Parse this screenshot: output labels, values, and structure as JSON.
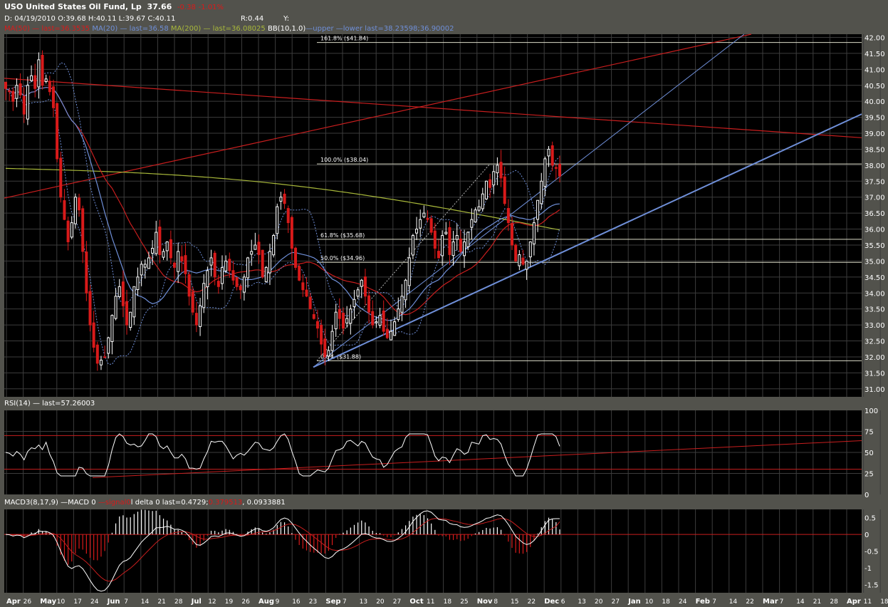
{
  "header": {
    "symbol_name": "USO United States Oil Fund, Lp",
    "last_price": "37.66",
    "change": "-0.38",
    "change_pct": "-1.01%",
    "ohlc": "D: 04/19/2010 O:39.68 H:40.11 L:39.67 C:40.11",
    "ratio": "R:0.44",
    "y_label": "Y:",
    "ma50": "MA(50) — last=36.3535",
    "ma20": "MA(20) — last=36.58",
    "ma200_prefix": "MA(200)",
    "ma200": "— last=36.08025",
    "bb_prefix": "BB(10,1.0)",
    "bb": "—upper —lower last=38.23598;36.90002"
  },
  "panels": {
    "rsi_title": "RSI(14) — last=57.26003",
    "macd_prefix": "MACD3(8,17,9) —MACD 0",
    "macd_signal": "—signal0",
    "macd_mid": "l delta 0 last=0.4729;",
    "macd_sig_val": "0.379513",
    "macd_delta_val": "0.0933881"
  },
  "colors": {
    "background": "#000000",
    "frame": "#52524c",
    "grid": "#3c3c3c",
    "candle_up": "#ffffff",
    "candle_down": "#d81a1a",
    "ma50": "#c81e1e",
    "ma20": "#6f8fd8",
    "ma200": "#a8b83a",
    "bb": "#6f8fd8",
    "trendline_red": "#c81e1e",
    "trendline_blue": "#6f8fd8",
    "fib": "#dcdcc8"
  },
  "chart_data": [
    {
      "type": "candlestick",
      "ylim": [
        30.75,
        42.1
      ],
      "yticks": [
        "42.00",
        "41.50",
        "41.00",
        "40.50",
        "40.00",
        "39.50",
        "39.00",
        "38.50",
        "38.00",
        "37.50",
        "37.00",
        "36.50",
        "36.00",
        "35.50",
        "35.00",
        "34.50",
        "34.00",
        "33.50",
        "33.00",
        "32.50",
        "32.00",
        "31.50",
        "31.00"
      ],
      "x_labels": [
        "Apr",
        "26",
        "May",
        "10",
        "17",
        "24",
        "Jun",
        "7",
        "14",
        "21",
        "28",
        "Jul",
        "12",
        "19",
        "26",
        "Aug",
        "9",
        "16",
        "23",
        "Sep",
        "7",
        "13",
        "20",
        "27",
        "Oct",
        "11",
        "18",
        "25",
        "Nov",
        "8",
        "15",
        "22",
        "Dec",
        "6",
        "13",
        "20",
        "27",
        "Jan",
        "10",
        "18",
        "24",
        "Feb",
        "7",
        "14",
        "22",
        "Mar",
        "7",
        "14",
        "21",
        "28",
        "Apr",
        "11",
        "18"
      ],
      "fib_levels": [
        {
          "label": "161.8%",
          "price": "($41.84)",
          "value": 41.84
        },
        {
          "label": "100.0%",
          "price": "($38.04)",
          "value": 38.04
        },
        {
          "label": "61.8%",
          "price": "($35.68)",
          "value": 35.68
        },
        {
          "label": "50.0%",
          "price": "($34.96)",
          "value": 34.96
        },
        {
          "label": "0.0%",
          "price": "($31.88)",
          "value": 31.88
        }
      ],
      "close": [
        40.4,
        40.3,
        40.0,
        40.5,
        40.2,
        39.6,
        40.5,
        40.8,
        40.4,
        41.3,
        40.5,
        40.7,
        40.3,
        39.8,
        38.2,
        37.0,
        36.3,
        35.6,
        36.2,
        37.0,
        36.6,
        35.3,
        34.0,
        33.0,
        32.3,
        31.8,
        31.9,
        32.0,
        32.6,
        33.3,
        33.9,
        34.2,
        33.6,
        33.0,
        33.4,
        34.2,
        34.5,
        34.9,
        34.9,
        35.1,
        35.4,
        35.9,
        35.2,
        35.3,
        35.6,
        35.1,
        34.8,
        35.3,
        35.0,
        34.6,
        33.9,
        33.4,
        33.0,
        33.6,
        34.3,
        34.7,
        35.1,
        34.5,
        34.2,
        34.8,
        35.0,
        34.7,
        34.4,
        34.2,
        34.1,
        34.5,
        35.1,
        35.3,
        35.5,
        35.2,
        34.5,
        34.8,
        35.3,
        35.8,
        36.7,
        37.0,
        36.8,
        36.2,
        35.4,
        34.8,
        34.4,
        34.1,
        33.9,
        33.5,
        33.2,
        32.9,
        32.4,
        32.0,
        32.2,
        32.8,
        33.4,
        33.2,
        32.9,
        33.2,
        33.5,
        33.8,
        34.1,
        34.4,
        33.9,
        33.4,
        33.0,
        33.1,
        33.3,
        32.8,
        32.6,
        32.8,
        33.1,
        33.5,
        33.9,
        34.4,
        35.1,
        35.8,
        36.0,
        36.3,
        36.5,
        36.3,
        35.9,
        35.4,
        35.1,
        35.8,
        35.9,
        35.2,
        35.6,
        35.8,
        35.3,
        35.6,
        35.9,
        36.3,
        36.6,
        36.7,
        37.1,
        37.5,
        37.3,
        37.8,
        38.0,
        37.6,
        36.8,
        36.2,
        35.5,
        35.0,
        35.2,
        34.9,
        35.0,
        35.6,
        36.2,
        36.9,
        37.5,
        38.2,
        38.5,
        38.0,
        37.9,
        37.66
      ],
      "ma20_last": 36.58,
      "ma50_last": 36.3535,
      "ma200_last": 36.08025,
      "bb_upper_last": 38.23598,
      "bb_lower_last": 36.90002
    },
    {
      "type": "line",
      "name": "RSI(14)",
      "ylim": [
        0,
        100
      ],
      "yticks": [
        "100",
        "75",
        "50",
        "25",
        "0"
      ],
      "levels": [
        70,
        30
      ],
      "last": 57.26003
    },
    {
      "type": "histogram",
      "name": "MACD3(8,17,9)",
      "ylim": [
        -1.75,
        0.75
      ],
      "yticks": [
        "0.5",
        "0",
        "-0.5",
        "-1",
        "-1.5"
      ],
      "macd_last": 0.4729,
      "signal_last": 0.379513,
      "delta_last": 0.0933881
    }
  ]
}
